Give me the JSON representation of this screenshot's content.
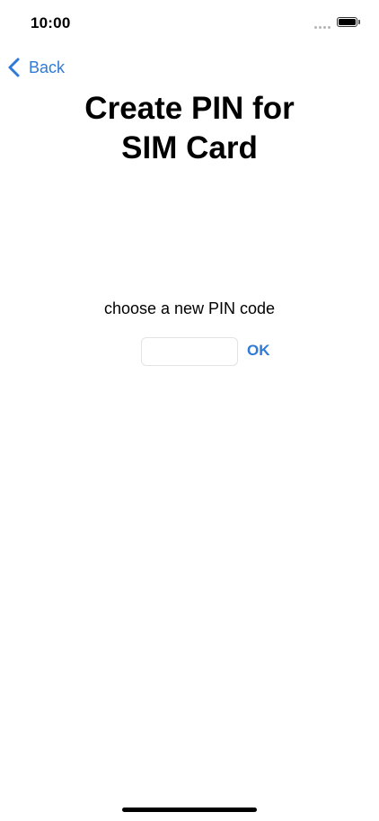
{
  "status_bar": {
    "time": "10:00"
  },
  "nav": {
    "back_label": "Back"
  },
  "title": {
    "line1": "Create PIN for",
    "line2": "SIM Card"
  },
  "form": {
    "prompt": "choose a new PIN code",
    "pin_value": "",
    "ok_label": "OK"
  },
  "colors": {
    "accent": "#2f7ad7"
  },
  "icons": {
    "back": "chevron-left-icon",
    "battery": "battery-icon",
    "signal": "signal-dots-icon"
  }
}
